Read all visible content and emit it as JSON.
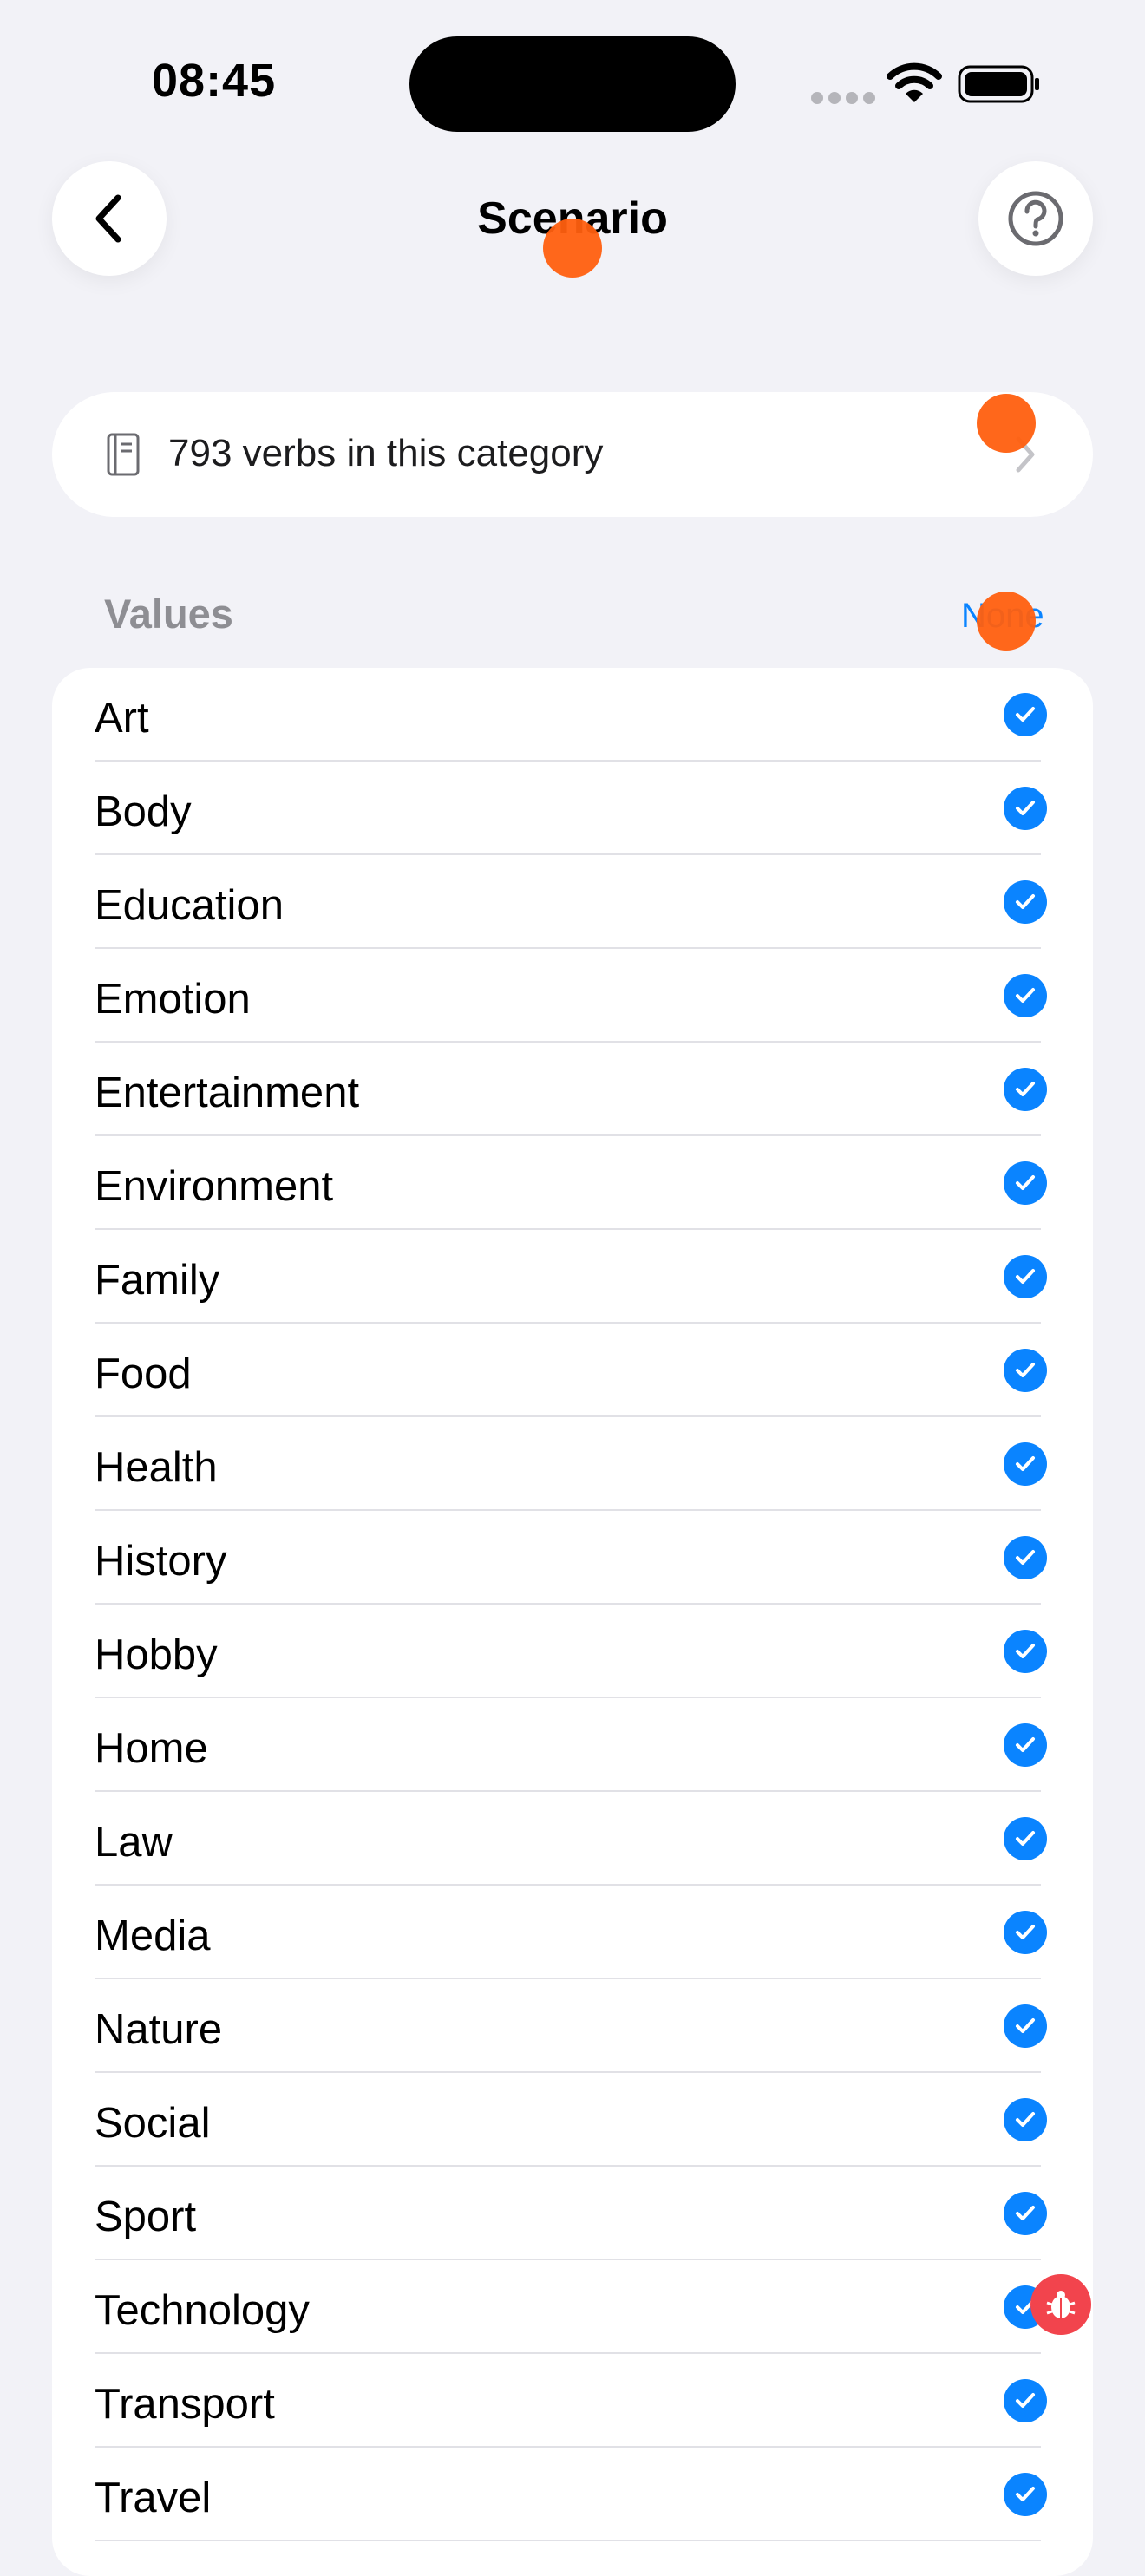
{
  "status_bar": {
    "time": "08:45"
  },
  "nav": {
    "title": "Scenario"
  },
  "info_card": {
    "text": "793 verbs in this category"
  },
  "section": {
    "header": "Values",
    "action_label": "None"
  },
  "items": [
    {
      "label": "Art",
      "checked": true
    },
    {
      "label": "Body",
      "checked": true
    },
    {
      "label": "Education",
      "checked": true
    },
    {
      "label": "Emotion",
      "checked": true
    },
    {
      "label": "Entertainment",
      "checked": true
    },
    {
      "label": "Environment",
      "checked": true
    },
    {
      "label": "Family",
      "checked": true
    },
    {
      "label": "Food",
      "checked": true
    },
    {
      "label": "Health",
      "checked": true
    },
    {
      "label": "History",
      "checked": true
    },
    {
      "label": "Hobby",
      "checked": true
    },
    {
      "label": "Home",
      "checked": true
    },
    {
      "label": "Law",
      "checked": true
    },
    {
      "label": "Media",
      "checked": true
    },
    {
      "label": "Nature",
      "checked": true
    },
    {
      "label": "Social",
      "checked": true
    },
    {
      "label": "Sport",
      "checked": true
    },
    {
      "label": "Technology",
      "checked": true
    },
    {
      "label": "Transport",
      "checked": true
    },
    {
      "label": "Travel",
      "checked": true
    }
  ],
  "colors": {
    "accent": "#0a84ff",
    "background": "#f2f2f7",
    "touch_marker": "#ff5f0f",
    "debug_badge": "#f2444d"
  },
  "icons": {
    "back": "chevron-left-icon",
    "help": "question-circle-icon",
    "info": "book-icon",
    "disclosure": "chevron-right-icon",
    "check": "checkmark-circle-icon",
    "debug": "ladybug-icon"
  }
}
